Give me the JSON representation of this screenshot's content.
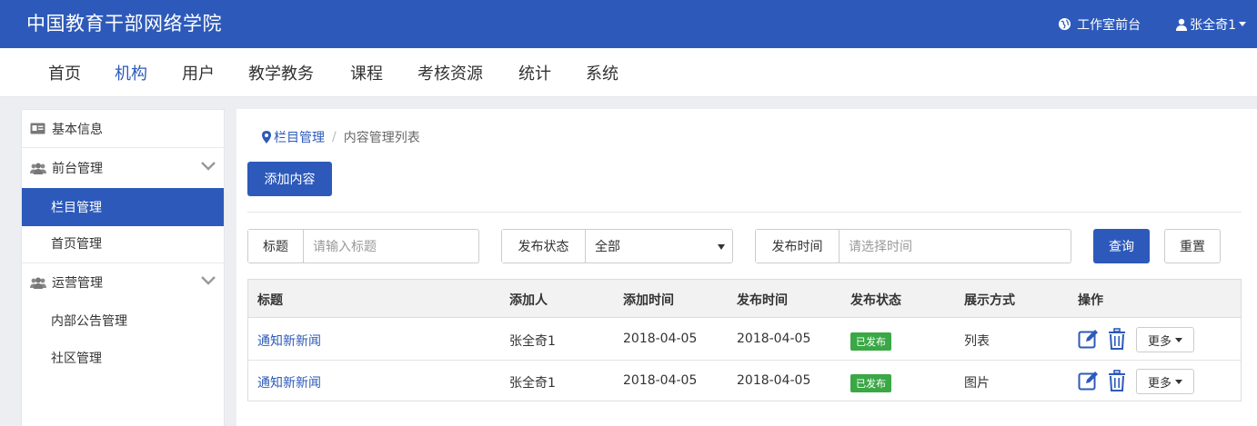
{
  "header": {
    "brand": "中国教育干部网络学院",
    "studio_link": "工作室前台",
    "user_name": "张全奇1"
  },
  "nav": {
    "items": [
      "首页",
      "机构",
      "用户",
      "教学教务",
      "课程",
      "考核资源",
      "统计",
      "系统"
    ],
    "active": "机构"
  },
  "sidebar": {
    "basic_info": "基本信息",
    "frontend_group": "前台管理",
    "column_mgmt": "栏目管理",
    "home_mgmt": "首页管理",
    "ops_group": "运营管理",
    "internal_notice": "内部公告管理",
    "community_mgmt": "社区管理"
  },
  "breadcrumb": {
    "parent": "栏目管理",
    "current": "内容管理列表"
  },
  "toolbar": {
    "add_content": "添加内容"
  },
  "filters": {
    "title_label": "标题",
    "title_placeholder": "请输入标题",
    "status_label": "发布状态",
    "status_value": "全部",
    "time_label": "发布时间",
    "time_placeholder": "请选择时间",
    "query_button": "查询",
    "reset_button": "重置"
  },
  "table": {
    "headers": [
      "标题",
      "添加人",
      "添加时间",
      "发布时间",
      "发布状态",
      "展示方式",
      "操作"
    ],
    "rows": [
      {
        "title": "通知新新闻",
        "adder": "张全奇1",
        "added": "2018-04-05",
        "published": "2018-04-05",
        "status": "已发布",
        "display": "列表",
        "more": "更多"
      },
      {
        "title": "通知新新闻",
        "adder": "张全奇1",
        "added": "2018-04-05",
        "published": "2018-04-05",
        "status": "已发布",
        "display": "图片",
        "more": "更多"
      }
    ]
  },
  "colors": {
    "primary": "#2d5aba",
    "success": "#3aa845"
  }
}
